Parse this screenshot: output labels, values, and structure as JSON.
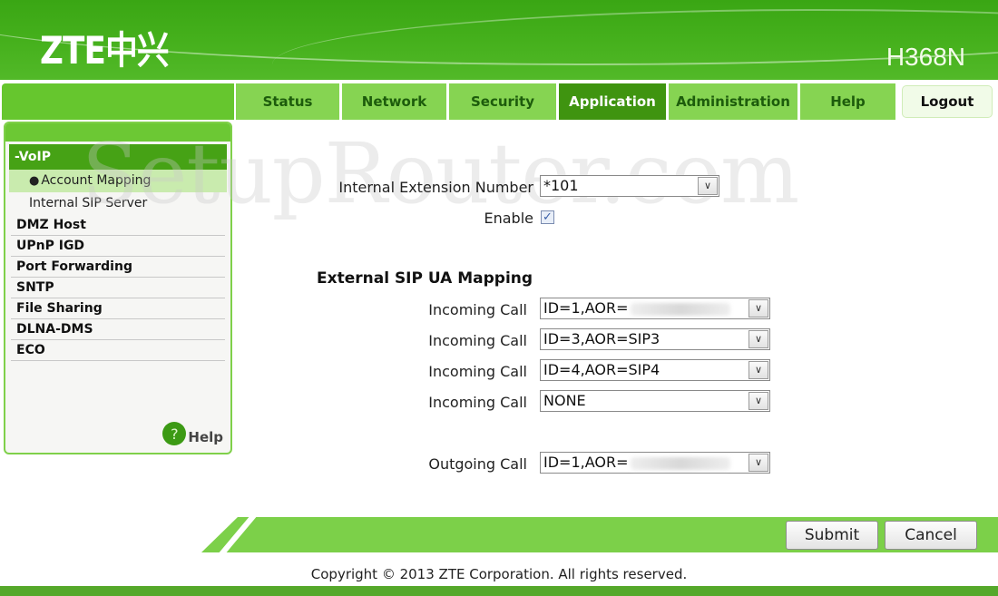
{
  "header": {
    "logo": "ZTE中兴",
    "model": "H368N"
  },
  "nav": {
    "tabs": [
      {
        "label": "Status",
        "active": false
      },
      {
        "label": "Network",
        "active": false
      },
      {
        "label": "Security",
        "active": false
      },
      {
        "label": "Application",
        "active": true
      },
      {
        "label": "Administration",
        "active": false
      },
      {
        "label": "Help",
        "active": false
      }
    ],
    "logout": "Logout"
  },
  "sidebar": {
    "section": "-VoIP",
    "sub_items": [
      {
        "label": "Account Mapping",
        "active": true
      },
      {
        "label": "Internal SIP Server",
        "active": false
      }
    ],
    "items": [
      "DMZ Host",
      "UPnP IGD",
      "Port Forwarding",
      "SNTP",
      "File Sharing",
      "DLNA-DMS",
      "ECO"
    ],
    "help": "Help",
    "help_icon": "?"
  },
  "watermark": "SetupRouter.com",
  "form": {
    "internal_ext_label": "Internal Extension Number",
    "internal_ext_value": "*101",
    "enable_label": "Enable",
    "enable_checked": true,
    "section_title": "External SIP UA Mapping",
    "incoming": [
      {
        "label": "Incoming Call",
        "value": "ID=1,AOR=",
        "redacted": true
      },
      {
        "label": "Incoming Call",
        "value": "ID=3,AOR=SIP3",
        "redacted": false
      },
      {
        "label": "Incoming Call",
        "value": "ID=4,AOR=SIP4",
        "redacted": false
      },
      {
        "label": "Incoming Call",
        "value": "NONE",
        "redacted": false
      }
    ],
    "outgoing": {
      "label": "Outgoing Call",
      "value": "ID=1,AOR=",
      "redacted": true
    }
  },
  "buttons": {
    "submit": "Submit",
    "cancel": "Cancel"
  },
  "footer": {
    "copyright": "Copyright © 2013 ZTE Corporation. All rights reserved."
  },
  "icons": {
    "dropdown": "chevron-down-icon",
    "check": "✓"
  }
}
